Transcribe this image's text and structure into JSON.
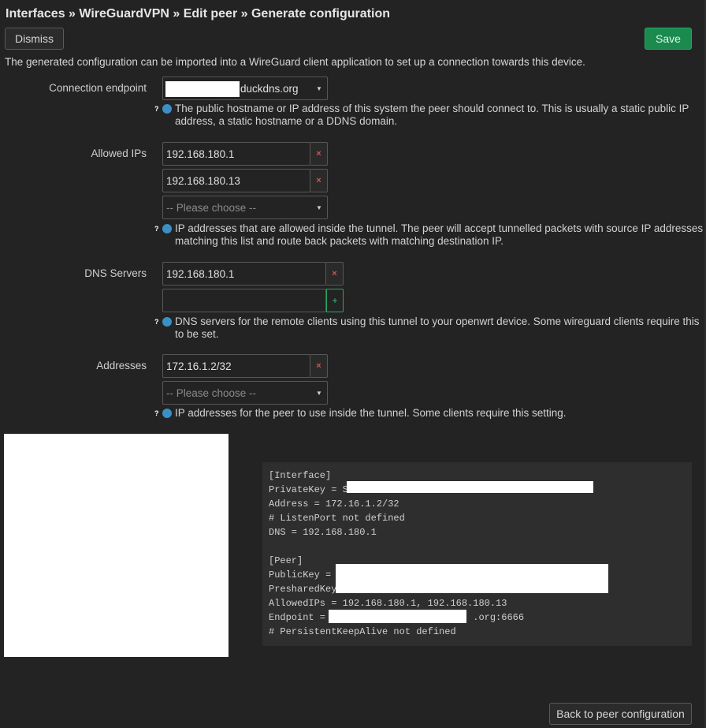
{
  "breadcrumb": "Interfaces » WireGuardVPN » Edit peer » Generate configuration",
  "buttons": {
    "dismiss": "Dismiss",
    "save": "Save",
    "back": "Back to peer configuration"
  },
  "intro": "The generated configuration can be imported into a WireGuard client application to set up a connection towards this device.",
  "endpoint": {
    "label": "Connection endpoint",
    "value_suffix": "duckdns.org",
    "help": "The public hostname or IP address of this system the peer should connect to. This is usually a static public IP address, a static hostname or a DDNS domain."
  },
  "allowed_ips": {
    "label": "Allowed IPs",
    "values": [
      "192.168.180.1",
      "192.168.180.13"
    ],
    "placeholder": "-- Please choose --",
    "help": "IP addresses that are allowed inside the tunnel. The peer will accept tunnelled packets with source IP addresses matching this list and route back packets with matching destination IP."
  },
  "dns": {
    "label": "DNS Servers",
    "values": [
      "192.168.180.1"
    ],
    "help": "DNS servers for the remote clients using this tunnel to your openwrt device. Some wireguard clients require this to be set."
  },
  "addresses": {
    "label": "Addresses",
    "values": [
      "172.16.1.2/32"
    ],
    "placeholder": "-- Please choose --",
    "help": "IP addresses for the peer to use inside the tunnel. Some clients require this setting."
  },
  "config_lines": [
    "[Interface]",
    "PrivateKey = S",
    "Address = 172.16.1.2/32",
    "# ListenPort not defined",
    "DNS = 192.168.180.1",
    "",
    "[Peer]",
    "PublicKey =",
    "PresharedKey",
    "AllowedIPs = 192.168.180.1, 192.168.180.13",
    "Endpoint =                          .org:6666",
    "# PersistentKeepAlive not defined"
  ]
}
